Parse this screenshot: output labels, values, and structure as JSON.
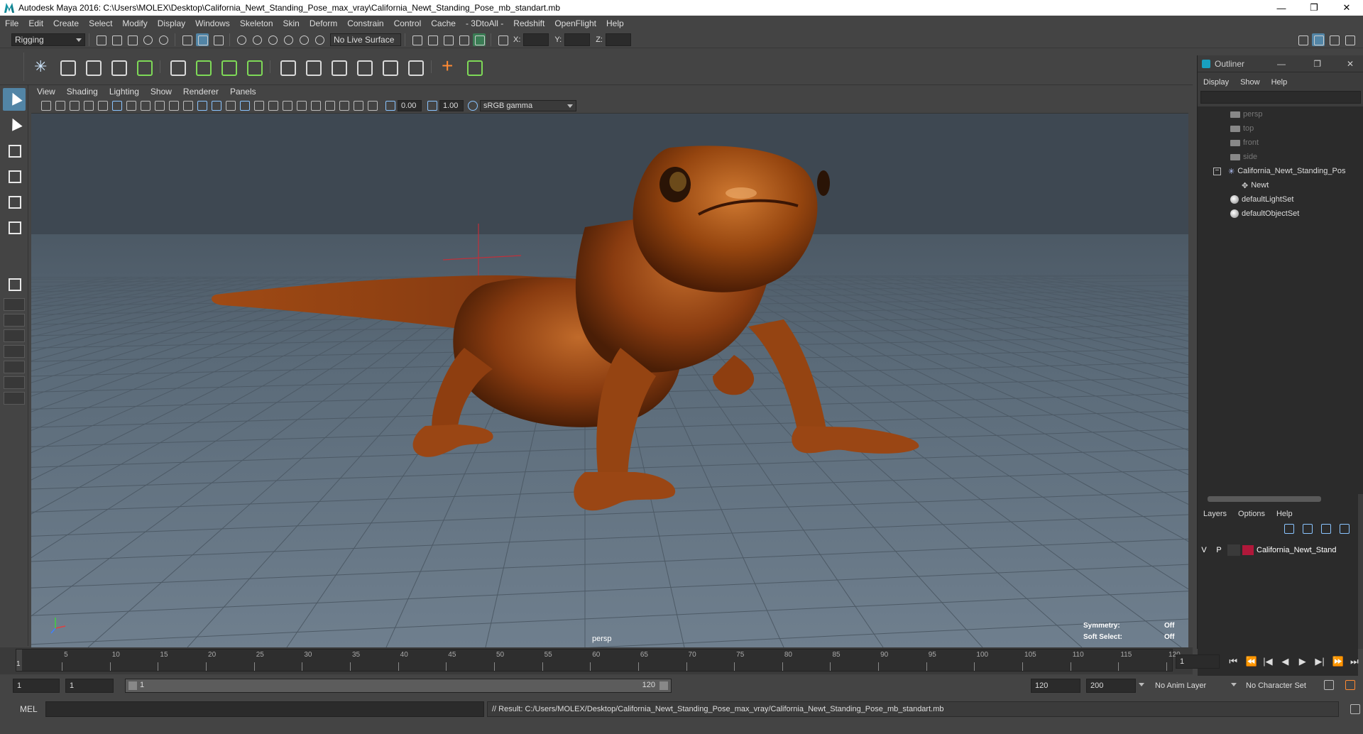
{
  "window": {
    "title": "Autodesk Maya 2016: C:\\Users\\MOLEX\\Desktop\\California_Newt_Standing_Pose_max_vray\\California_Newt_Standing_Pose_mb_standart.mb",
    "minimize": "—",
    "maximize": "❐",
    "close": "✕"
  },
  "menubar": [
    "File",
    "Edit",
    "Create",
    "Select",
    "Modify",
    "Display",
    "Windows",
    "Skeleton",
    "Skin",
    "Deform",
    "Constrain",
    "Control",
    "Cache",
    "- 3DtoAll -",
    "Redshift",
    "OpenFlight",
    "Help"
  ],
  "statusline": {
    "menuset": "Rigging",
    "live_surface": "No Live Surface",
    "x_label": "X:",
    "y_label": "Y:",
    "z_label": "Z:"
  },
  "viewport": {
    "menu": [
      "View",
      "Shading",
      "Lighting",
      "Show",
      "Renderer",
      "Panels"
    ],
    "exposure": "0.00",
    "gamma": "1.00",
    "color_space": "sRGB gamma",
    "camera_label": "persp",
    "symmetry_label": "Symmetry:",
    "symmetry_value": "Off",
    "soft_select_label": "Soft Select:",
    "soft_select_value": "Off",
    "colors": {
      "newt_body": "#8a3c10",
      "newt_light": "#c06a2a",
      "grid": "#4d5a66",
      "crosshair": "#c0303a"
    }
  },
  "timeline": {
    "start_label": "1",
    "ticks": [
      "5",
      "10",
      "15",
      "20",
      "25",
      "30",
      "35",
      "40",
      "45",
      "50",
      "55",
      "60",
      "65",
      "70",
      "75",
      "80",
      "85",
      "90",
      "95",
      "100",
      "105",
      "110",
      "115",
      "120"
    ],
    "current_frame": "1"
  },
  "range": {
    "start": "1",
    "playback_start": "1",
    "slider_start": "1",
    "slider_end": "120",
    "playback_end": "120",
    "end": "200",
    "anim_layer": "No Anim Layer",
    "character_set": "No Character Set"
  },
  "command": {
    "lang": "MEL",
    "result": "// Result: C:/Users/MOLEX/Desktop/California_Newt_Standing_Pose_max_vray/California_Newt_Standing_Pose_mb_standart.mb"
  },
  "outliner": {
    "title": "Outliner",
    "menu": [
      "Display",
      "Show",
      "Help"
    ],
    "items": [
      {
        "label": "persp",
        "dim": true
      },
      {
        "label": "top",
        "dim": true
      },
      {
        "label": "front",
        "dim": true
      },
      {
        "label": "side",
        "dim": true
      },
      {
        "label": "California_Newt_Standing_Pos",
        "dim": false
      },
      {
        "label": "Newt",
        "dim": false
      },
      {
        "label": "defaultLightSet",
        "dim": false
      },
      {
        "label": "defaultObjectSet",
        "dim": false
      }
    ],
    "layer_menu": [
      "Layers",
      "Options",
      "Help"
    ],
    "layer": {
      "v": "V",
      "p": "P",
      "name": "California_Newt_Stand",
      "color": "#b0183a"
    }
  }
}
